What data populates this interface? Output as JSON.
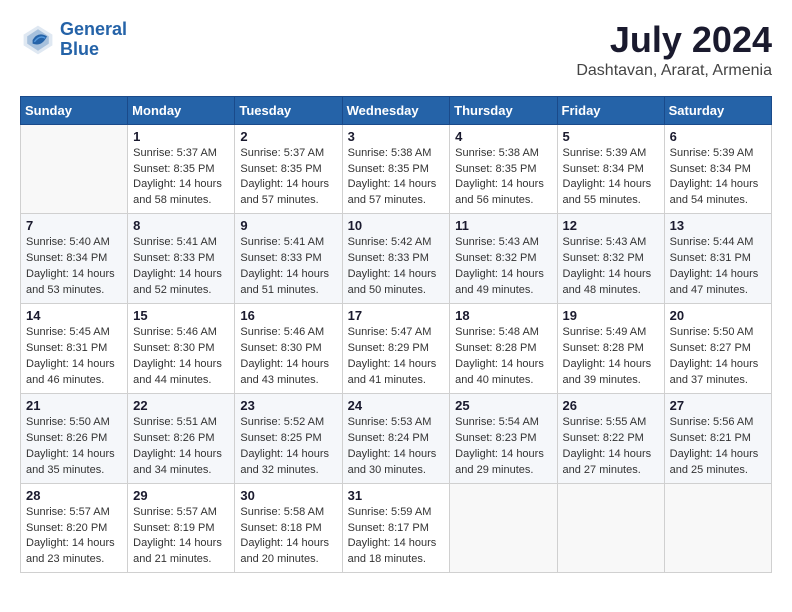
{
  "header": {
    "logo_line1": "General",
    "logo_line2": "Blue",
    "month_year": "July 2024",
    "location": "Dashtavan, Ararat, Armenia"
  },
  "weekdays": [
    "Sunday",
    "Monday",
    "Tuesday",
    "Wednesday",
    "Thursday",
    "Friday",
    "Saturday"
  ],
  "weeks": [
    [
      {
        "day": "",
        "info": ""
      },
      {
        "day": "1",
        "info": "Sunrise: 5:37 AM\nSunset: 8:35 PM\nDaylight: 14 hours\nand 58 minutes."
      },
      {
        "day": "2",
        "info": "Sunrise: 5:37 AM\nSunset: 8:35 PM\nDaylight: 14 hours\nand 57 minutes."
      },
      {
        "day": "3",
        "info": "Sunrise: 5:38 AM\nSunset: 8:35 PM\nDaylight: 14 hours\nand 57 minutes."
      },
      {
        "day": "4",
        "info": "Sunrise: 5:38 AM\nSunset: 8:35 PM\nDaylight: 14 hours\nand 56 minutes."
      },
      {
        "day": "5",
        "info": "Sunrise: 5:39 AM\nSunset: 8:34 PM\nDaylight: 14 hours\nand 55 minutes."
      },
      {
        "day": "6",
        "info": "Sunrise: 5:39 AM\nSunset: 8:34 PM\nDaylight: 14 hours\nand 54 minutes."
      }
    ],
    [
      {
        "day": "7",
        "info": "Sunrise: 5:40 AM\nSunset: 8:34 PM\nDaylight: 14 hours\nand 53 minutes."
      },
      {
        "day": "8",
        "info": "Sunrise: 5:41 AM\nSunset: 8:33 PM\nDaylight: 14 hours\nand 52 minutes."
      },
      {
        "day": "9",
        "info": "Sunrise: 5:41 AM\nSunset: 8:33 PM\nDaylight: 14 hours\nand 51 minutes."
      },
      {
        "day": "10",
        "info": "Sunrise: 5:42 AM\nSunset: 8:33 PM\nDaylight: 14 hours\nand 50 minutes."
      },
      {
        "day": "11",
        "info": "Sunrise: 5:43 AM\nSunset: 8:32 PM\nDaylight: 14 hours\nand 49 minutes."
      },
      {
        "day": "12",
        "info": "Sunrise: 5:43 AM\nSunset: 8:32 PM\nDaylight: 14 hours\nand 48 minutes."
      },
      {
        "day": "13",
        "info": "Sunrise: 5:44 AM\nSunset: 8:31 PM\nDaylight: 14 hours\nand 47 minutes."
      }
    ],
    [
      {
        "day": "14",
        "info": "Sunrise: 5:45 AM\nSunset: 8:31 PM\nDaylight: 14 hours\nand 46 minutes."
      },
      {
        "day": "15",
        "info": "Sunrise: 5:46 AM\nSunset: 8:30 PM\nDaylight: 14 hours\nand 44 minutes."
      },
      {
        "day": "16",
        "info": "Sunrise: 5:46 AM\nSunset: 8:30 PM\nDaylight: 14 hours\nand 43 minutes."
      },
      {
        "day": "17",
        "info": "Sunrise: 5:47 AM\nSunset: 8:29 PM\nDaylight: 14 hours\nand 41 minutes."
      },
      {
        "day": "18",
        "info": "Sunrise: 5:48 AM\nSunset: 8:28 PM\nDaylight: 14 hours\nand 40 minutes."
      },
      {
        "day": "19",
        "info": "Sunrise: 5:49 AM\nSunset: 8:28 PM\nDaylight: 14 hours\nand 39 minutes."
      },
      {
        "day": "20",
        "info": "Sunrise: 5:50 AM\nSunset: 8:27 PM\nDaylight: 14 hours\nand 37 minutes."
      }
    ],
    [
      {
        "day": "21",
        "info": "Sunrise: 5:50 AM\nSunset: 8:26 PM\nDaylight: 14 hours\nand 35 minutes."
      },
      {
        "day": "22",
        "info": "Sunrise: 5:51 AM\nSunset: 8:26 PM\nDaylight: 14 hours\nand 34 minutes."
      },
      {
        "day": "23",
        "info": "Sunrise: 5:52 AM\nSunset: 8:25 PM\nDaylight: 14 hours\nand 32 minutes."
      },
      {
        "day": "24",
        "info": "Sunrise: 5:53 AM\nSunset: 8:24 PM\nDaylight: 14 hours\nand 30 minutes."
      },
      {
        "day": "25",
        "info": "Sunrise: 5:54 AM\nSunset: 8:23 PM\nDaylight: 14 hours\nand 29 minutes."
      },
      {
        "day": "26",
        "info": "Sunrise: 5:55 AM\nSunset: 8:22 PM\nDaylight: 14 hours\nand 27 minutes."
      },
      {
        "day": "27",
        "info": "Sunrise: 5:56 AM\nSunset: 8:21 PM\nDaylight: 14 hours\nand 25 minutes."
      }
    ],
    [
      {
        "day": "28",
        "info": "Sunrise: 5:57 AM\nSunset: 8:20 PM\nDaylight: 14 hours\nand 23 minutes."
      },
      {
        "day": "29",
        "info": "Sunrise: 5:57 AM\nSunset: 8:19 PM\nDaylight: 14 hours\nand 21 minutes."
      },
      {
        "day": "30",
        "info": "Sunrise: 5:58 AM\nSunset: 8:18 PM\nDaylight: 14 hours\nand 20 minutes."
      },
      {
        "day": "31",
        "info": "Sunrise: 5:59 AM\nSunset: 8:17 PM\nDaylight: 14 hours\nand 18 minutes."
      },
      {
        "day": "",
        "info": ""
      },
      {
        "day": "",
        "info": ""
      },
      {
        "day": "",
        "info": ""
      }
    ]
  ]
}
